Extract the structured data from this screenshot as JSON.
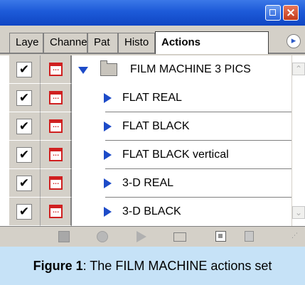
{
  "panel": {
    "tabs": [
      {
        "label": "Laye"
      },
      {
        "label": "Channe"
      },
      {
        "label": "Pat"
      },
      {
        "label": "Histo"
      },
      {
        "label": "Actions",
        "active": true
      }
    ],
    "action_set": {
      "name": "FILM MACHINE 3 PICS",
      "expanded": true,
      "checked": true
    },
    "actions": [
      {
        "name": "FLAT REAL",
        "checked": true
      },
      {
        "name": "FLAT BLACK",
        "checked": true
      },
      {
        "name": "FLAT BLACK vertical",
        "checked": true
      },
      {
        "name": "3-D REAL",
        "checked": true
      },
      {
        "name": "3-D BLACK",
        "checked": true
      }
    ],
    "toolbar_icons": [
      "stop-icon",
      "record-icon",
      "play-icon",
      "new-set-folder-icon",
      "new-action-icon",
      "trash-icon"
    ],
    "checkmark": "✔"
  },
  "caption": {
    "label": "Figure 1",
    "text": ": The FILM MACHINE actions set"
  },
  "colors": {
    "titlebar": "#1d5ad8",
    "panel_bg": "#d4d0c8",
    "caption_bg": "#c6e2f7",
    "dialog_red": "#d02020",
    "play_blue": "#1d4bc8"
  }
}
